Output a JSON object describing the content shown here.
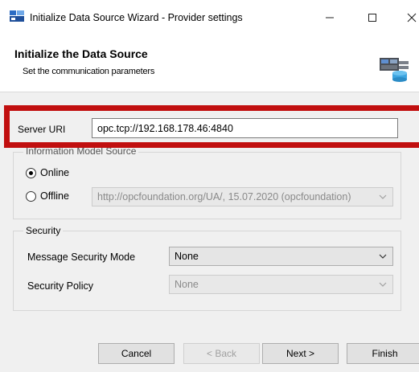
{
  "window": {
    "title": "Initialize Data Source Wizard - Provider settings",
    "minimize": "—",
    "maximize": "☐",
    "close": "✕"
  },
  "header": {
    "title": "Initialize the Data Source",
    "subtitle": "Set the communication parameters"
  },
  "server": {
    "label": "Server URI",
    "value": "opc.tcp://192.168.178.46:4840"
  },
  "info_model": {
    "group_label": "Information Model Source",
    "online_label": "Online",
    "online_checked": true,
    "offline_label": "Offline",
    "offline_checked": false,
    "offline_value": "http://opcfoundation.org/UA/, 15.07.2020 (opcfoundation)"
  },
  "security": {
    "group_label": "Security",
    "mode_label": "Message Security Mode",
    "mode_value": "None",
    "policy_label": "Security Policy",
    "policy_value": "None"
  },
  "buttons": {
    "cancel": "Cancel",
    "back": "< Back",
    "next": "Next >",
    "finish": "Finish"
  },
  "colors": {
    "highlight_frame": "#c10f0f",
    "dialog_background": "#f0f0f0"
  },
  "icons": {
    "app": "wizard-app-icon",
    "header": "data-source-icon",
    "dropdown": "chevron-down-icon"
  }
}
